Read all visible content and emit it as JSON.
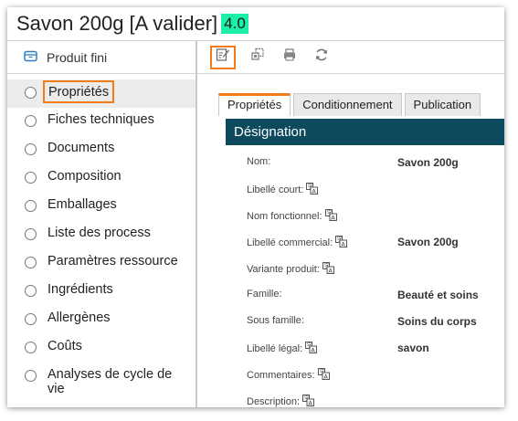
{
  "header": {
    "title": "Savon 200g [A valider]",
    "version": "4.0"
  },
  "sidebar": {
    "header_label": "Produit fini",
    "items": [
      {
        "label": "Propriétés"
      },
      {
        "label": "Fiches techniques"
      },
      {
        "label": "Documents"
      },
      {
        "label": "Composition"
      },
      {
        "label": "Emballages"
      },
      {
        "label": "Liste des process"
      },
      {
        "label": "Paramètres ressource"
      },
      {
        "label": "Ingrédients"
      },
      {
        "label": "Allergènes"
      },
      {
        "label": "Coûts"
      },
      {
        "label": "Analyses de cycle de vie"
      }
    ]
  },
  "toolbar": {
    "icons": [
      "edit-icon",
      "copy-icon",
      "print-icon",
      "refresh-icon"
    ]
  },
  "tabs": [
    {
      "label": "Propriétés"
    },
    {
      "label": "Conditionnement"
    },
    {
      "label": "Publication"
    }
  ],
  "section": {
    "title": "Désignation"
  },
  "form": {
    "fields": [
      {
        "label": "Nom:",
        "value": "Savon 200g"
      },
      {
        "label": "Libellé court:",
        "value": ""
      },
      {
        "label": "Nom fonctionnel:",
        "value": ""
      },
      {
        "label": "Libellé commercial:",
        "value": "Savon 200g"
      },
      {
        "label": "Variante produit:",
        "value": ""
      },
      {
        "label": "Famille:",
        "value": "Beauté et soins"
      },
      {
        "label": "Sous famille:",
        "value": "Soins du corps"
      },
      {
        "label": "Libellé légal:",
        "value": "savon"
      },
      {
        "label": "Commentaires:",
        "value": ""
      },
      {
        "label": "Description:",
        "value": ""
      }
    ]
  },
  "colors": {
    "accent": "#f07c1a",
    "section_bg": "#0d4a5e",
    "badge": "#1bf0a6"
  }
}
